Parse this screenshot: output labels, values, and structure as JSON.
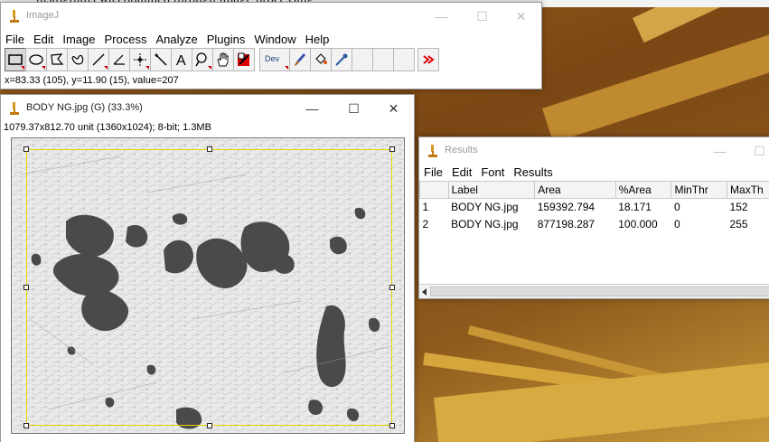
{
  "desktop": {
    "caption_fragment": "histograms was obtained through image processing"
  },
  "imagej": {
    "title": "ImageJ",
    "menu": [
      "File",
      "Edit",
      "Image",
      "Process",
      "Analyze",
      "Plugins",
      "Window",
      "Help"
    ],
    "tools": [
      "rectangle-tool",
      "oval-tool",
      "polygon-tool",
      "freehand-tool",
      "line-tool",
      "angle-tool",
      "point-tool",
      "wand-tool",
      "text-tool",
      "magnifier-tool",
      "hand-tool",
      "color-picker-tool"
    ],
    "dev_label": "Dev",
    "status": "x=83.33 (105), y=11.90 (15), value=207",
    "window_controls": {
      "minimize": "—",
      "maximize": "☐",
      "close": "✕"
    }
  },
  "image_window": {
    "title": "BODY NG.jpg (G) (33.3%)",
    "info": "1079.37x812.70 unit (1360x1024); 8-bit; 1.3MB",
    "window_controls": {
      "minimize": "—",
      "maximize": "☐",
      "close": "✕"
    }
  },
  "results_window": {
    "title": "Results",
    "menu": [
      "File",
      "Edit",
      "Font",
      "Results"
    ],
    "columns": [
      "",
      "Label",
      "Area",
      "%Area",
      "MinThr",
      "MaxTh"
    ],
    "rows": [
      [
        "1",
        "BODY NG.jpg",
        "159392.794",
        "18.171",
        "0",
        "152"
      ],
      [
        "2",
        "BODY NG.jpg",
        "877198.287",
        "100.000",
        "0",
        "255"
      ]
    ],
    "window_controls": {
      "minimize": "—",
      "maximize": "☐"
    }
  },
  "colors": {
    "roi": "#e8d400",
    "blob": "#4a4a4a",
    "wallpaper_dark": "#7a4614",
    "wallpaper_light": "#e2b44a"
  }
}
